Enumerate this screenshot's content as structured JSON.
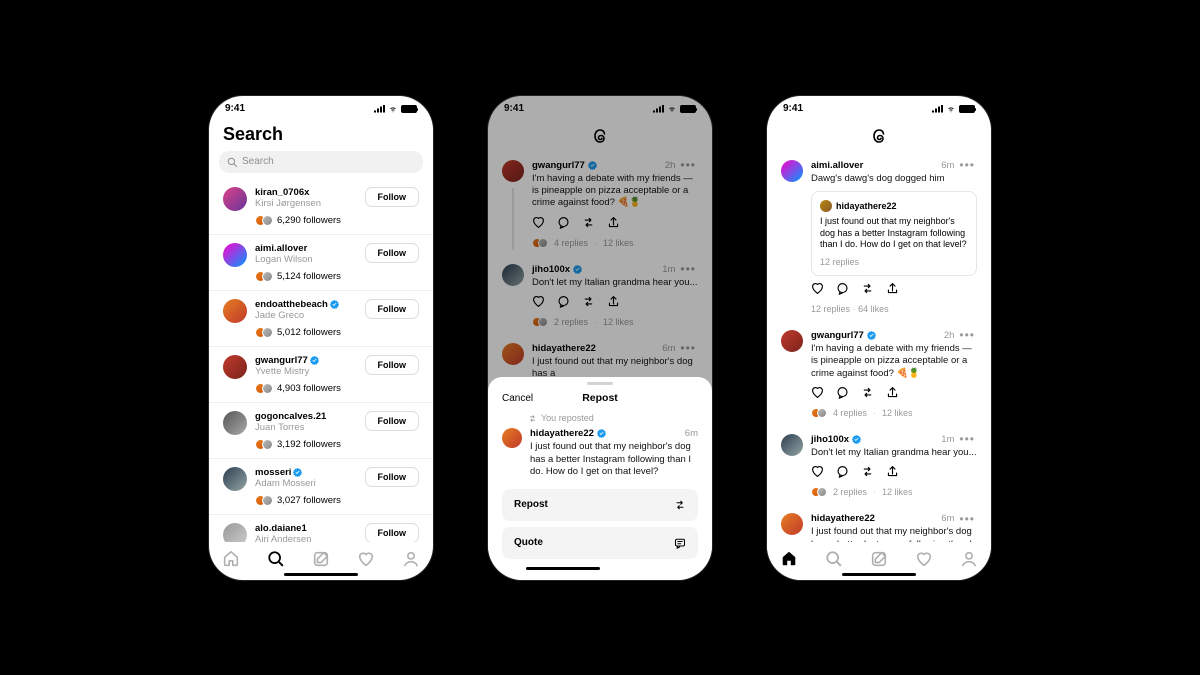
{
  "status": {
    "time": "9:41"
  },
  "screen1": {
    "title": "Search",
    "search_placeholder": "Search",
    "follow_label": "Follow",
    "users": [
      {
        "username": "kiran_0706x",
        "fullname": "Kirsi Jørgensen",
        "followers": "6,290 followers",
        "verified": false
      },
      {
        "username": "aimi.allover",
        "fullname": "Logan Wilson",
        "followers": "5,124 followers",
        "verified": false
      },
      {
        "username": "endoatthebeach",
        "fullname": "Jade Greco",
        "followers": "5,012 followers",
        "verified": true
      },
      {
        "username": "gwangurl77",
        "fullname": "Yvette Mistry",
        "followers": "4,903 followers",
        "verified": true
      },
      {
        "username": "gogoncalves.21",
        "fullname": "Juan Torres",
        "followers": "3,192 followers",
        "verified": false
      },
      {
        "username": "mosseri",
        "fullname": "Adam Mosseri",
        "followers": "3,027 followers",
        "verified": true
      },
      {
        "username": "alo.daiane1",
        "fullname": "Airi Andersen",
        "followers": "",
        "verified": false
      }
    ]
  },
  "screen2": {
    "posts": [
      {
        "username": "gwangurl77",
        "verified": true,
        "time": "2h",
        "body": "I'm having a debate with my friends — is pineapple on pizza acceptable or a crime against food? 🍕🍍",
        "replies": "4 replies",
        "likes": "12 likes"
      },
      {
        "username": "jiho100x",
        "verified": true,
        "time": "1m",
        "body": "Don't let my Italian grandma hear you...",
        "replies": "2 replies",
        "likes": "12 likes"
      },
      {
        "username": "hidayathere22",
        "verified": false,
        "time": "6m",
        "body": "I just found out that my neighbor's dog has a",
        "replies": "",
        "likes": ""
      }
    ],
    "sheet": {
      "cancel": "Cancel",
      "title": "Repost",
      "you_reposted": "You reposted",
      "post": {
        "username": "hidayathere22",
        "verified": true,
        "time": "6m",
        "body": "I just found out that my neighbor's dog has a better Instagram following than I do. How do I get on that level?"
      },
      "repost_btn": "Repost",
      "quote_btn": "Quote"
    }
  },
  "screen3": {
    "posts": [
      {
        "username": "aimi.allover",
        "verified": false,
        "time": "6m",
        "body": "Dawg's dawg's dog dogged him",
        "quote": {
          "username": "hidayathere22",
          "body": "I just found out that my neighbor's dog has a better Instagram following than I do. How do I get on that level?",
          "meta": "12 replies"
        },
        "replies": "12 replies",
        "likes": "64 likes"
      },
      {
        "username": "gwangurl77",
        "verified": true,
        "time": "2h",
        "body": "I'm having a debate with my friends — is pineapple on pizza acceptable or a crime against food? 🍕🍍",
        "replies": "4 replies",
        "likes": "12 likes"
      },
      {
        "username": "jiho100x",
        "verified": true,
        "time": "1m",
        "body": "Don't let my Italian grandma hear you...",
        "replies": "2 replies",
        "likes": "12 likes"
      },
      {
        "username": "hidayathere22",
        "verified": false,
        "time": "6m",
        "body": "I just found out that my neighbor's dog has a better Instagram following than I do. How do I",
        "replies": "",
        "likes": ""
      }
    ]
  }
}
